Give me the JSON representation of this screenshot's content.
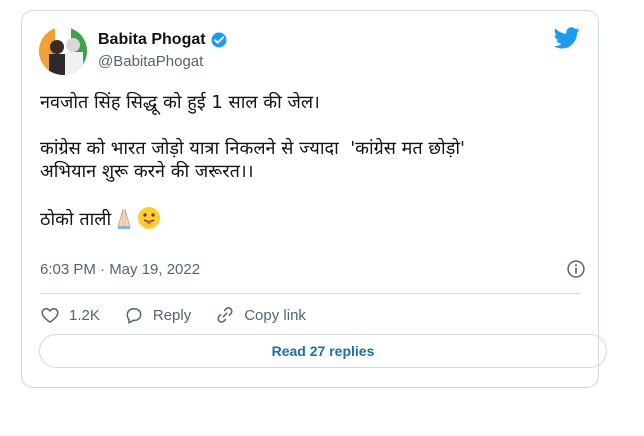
{
  "tweet": {
    "author_name": "Babita Phogat",
    "author_handle": "@BabitaPhogat",
    "lines": [
      "नवजोत सिंह सिद्धू को हुई 1 साल की जेल।",
      "कांग्रेस को भारत जोड़ो यात्रा निकलने से ज्यादा  'कांग्रेस मत छोड़ो'\nअभियान शुरू करने की जरूरत।।",
      "ठोको ताली"
    ],
    "emojis": [
      "folded-hands",
      "face-with-tongue"
    ],
    "timestamp": "6:03 PM · May 19, 2022",
    "verified": true
  },
  "actions": {
    "likes": "1.2K",
    "reply_label": "Reply",
    "copy_label": "Copy link"
  },
  "read_replies": "Read 27 replies",
  "colors": {
    "accent": "#1d9bf0",
    "muted": "#536471",
    "border": "#cfd9de",
    "like_red": "#f91880"
  }
}
